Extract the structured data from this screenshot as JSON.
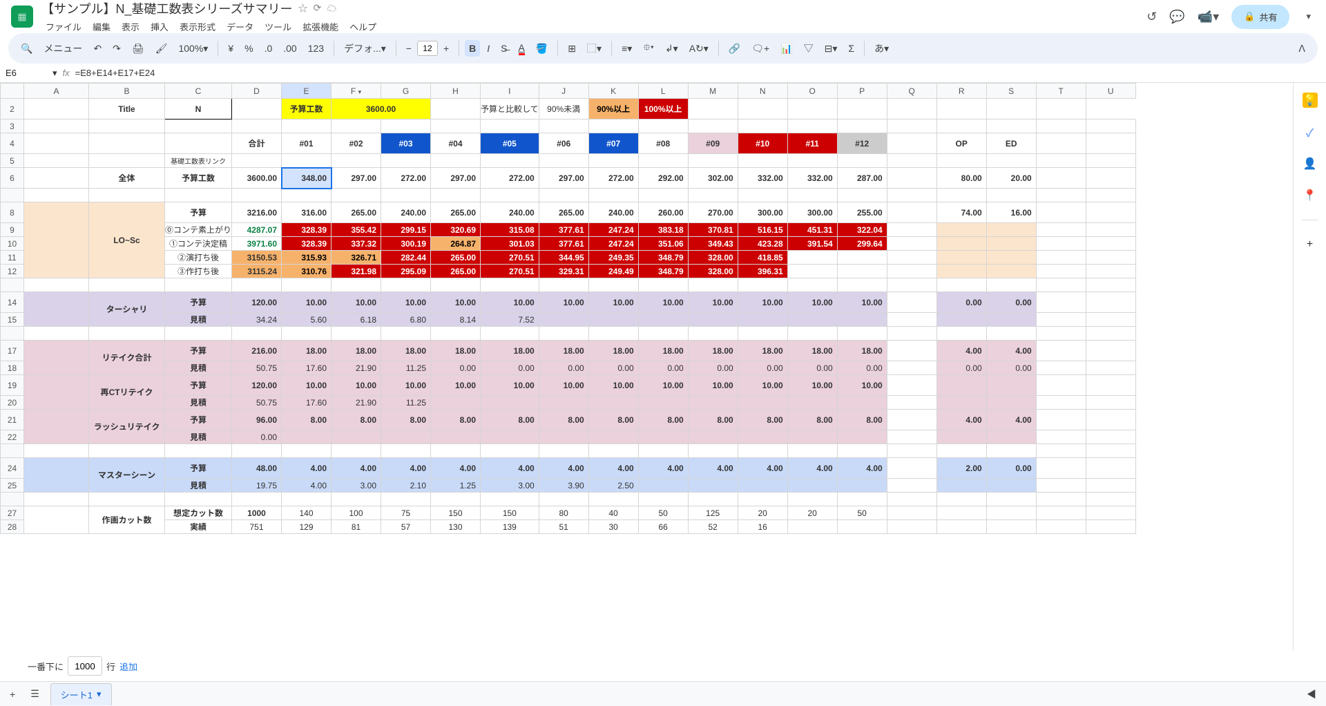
{
  "doc": {
    "title": "【サンプル】N_基礎工数表シリーズサマリー"
  },
  "menu": {
    "file": "ファイル",
    "edit": "編集",
    "view": "表示",
    "insert": "挿入",
    "format": "表示形式",
    "data": "データ",
    "tools": "ツール",
    "ext": "拡張機能",
    "help": "ヘルプ"
  },
  "share": "共有",
  "toolbar": {
    "menus": "メニュー",
    "zoom": "100%",
    "font": "デフォ...",
    "size": "12"
  },
  "namebox": "E6",
  "formula": "=E8+E14+E17+E24",
  "cols": [
    "A",
    "B",
    "C",
    "D",
    "E",
    "F",
    "G",
    "H",
    "I",
    "J",
    "K",
    "L",
    "M",
    "N",
    "O",
    "P",
    "Q",
    "R",
    "S",
    "T",
    "U"
  ],
  "row": {
    "2": "2",
    "3": "3",
    "4": "4",
    "5": "5",
    "6": "6",
    "8": "8",
    "9": "9",
    "10": "10",
    "11": "11",
    "12": "12",
    "14": "14",
    "15": "15",
    "17": "17",
    "18": "18",
    "19": "19",
    "20": "20",
    "21": "21",
    "22": "22",
    "24": "24",
    "25": "25",
    "27": "27",
    "28": "28"
  },
  "top": {
    "titleLbl": "Title",
    "titleVal": "N",
    "yosanLbl": "予算工数",
    "yosanVal": "3600.00",
    "compLbl": "予算と比較して",
    "lt90": "90%未満",
    "ge90": "90%以上",
    "ge100": "100%以上"
  },
  "hdr": {
    "sum": "合計",
    "eps": [
      "#01",
      "#02",
      "#03",
      "#04",
      "#05",
      "#06",
      "#07",
      "#08",
      "#09",
      "#10",
      "#11",
      "#12"
    ],
    "op": "OP",
    "ed": "ED"
  },
  "link": "基礎工数表リンク",
  "sec": {
    "zentai": "全体",
    "losc": "LO~Sc",
    "tertiary": "ターシャリ",
    "retake": "リテイク合計",
    "rect": "再CTリテイク",
    "rush": "ラッシュリテイク",
    "master": "マスターシーン",
    "cut": "作画カット数"
  },
  "lbl": {
    "yosanKosu": "予算工数",
    "yosan": "予算",
    "mitsumori": "見積",
    "c0": "⓪コンテ素上がり",
    "c1": "①コンテ決定稿",
    "c2": "②演打ち後",
    "c3": "③作打ち後",
    "soutei": "想定カット数",
    "jisseki": "実績"
  },
  "d": {
    "yk": {
      "sum": "3600.00",
      "v": [
        "348.00",
        "297.00",
        "272.00",
        "297.00",
        "272.00",
        "297.00",
        "272.00",
        "292.00",
        "302.00",
        "332.00",
        "332.00",
        "287.00"
      ],
      "op": "80.00",
      "ed": "20.00"
    },
    "losc_y": {
      "sum": "3216.00",
      "v": [
        "316.00",
        "265.00",
        "240.00",
        "265.00",
        "240.00",
        "265.00",
        "240.00",
        "260.00",
        "270.00",
        "300.00",
        "300.00",
        "255.00"
      ],
      "op": "74.00",
      "ed": "16.00"
    },
    "losc0": {
      "sum": "4287.07",
      "v": [
        "328.39",
        "355.42",
        "299.15",
        "320.69",
        "315.08",
        "377.61",
        "247.24",
        "383.18",
        "370.81",
        "516.15",
        "451.31",
        "322.04"
      ]
    },
    "losc1": {
      "sum": "3971.60",
      "v": [
        "328.39",
        "337.32",
        "300.19",
        "264.87",
        "301.03",
        "377.61",
        "247.24",
        "351.06",
        "349.43",
        "423.28",
        "391.54",
        "299.64"
      ]
    },
    "losc2": {
      "sum": "3150.53",
      "v": [
        "315.93",
        "326.71",
        "282.44",
        "265.00",
        "270.51",
        "344.95",
        "249.35",
        "348.79",
        "328.00",
        "418.85",
        "",
        ""
      ]
    },
    "losc3": {
      "sum": "3115.24",
      "v": [
        "310.76",
        "321.98",
        "295.09",
        "265.00",
        "270.51",
        "329.31",
        "249.49",
        "348.79",
        "328.00",
        "396.31",
        "",
        ""
      ]
    },
    "ter_y": {
      "sum": "120.00",
      "v": [
        "10.00",
        "10.00",
        "10.00",
        "10.00",
        "10.00",
        "10.00",
        "10.00",
        "10.00",
        "10.00",
        "10.00",
        "10.00",
        "10.00"
      ],
      "op": "0.00",
      "ed": "0.00"
    },
    "ter_m": {
      "sum": "34.24",
      "v": [
        "5.60",
        "6.18",
        "6.80",
        "8.14",
        "7.52",
        "",
        "",
        "",
        "",
        "",
        "",
        ""
      ]
    },
    "rt_y": {
      "sum": "216.00",
      "v": [
        "18.00",
        "18.00",
        "18.00",
        "18.00",
        "18.00",
        "18.00",
        "18.00",
        "18.00",
        "18.00",
        "18.00",
        "18.00",
        "18.00"
      ],
      "op": "4.00",
      "ed": "4.00"
    },
    "rt_m": {
      "sum": "50.75",
      "v": [
        "17.60",
        "21.90",
        "11.25",
        "0.00",
        "0.00",
        "0.00",
        "0.00",
        "0.00",
        "0.00",
        "0.00",
        "0.00",
        "0.00"
      ],
      "op": "0.00",
      "ed": "0.00"
    },
    "rc_y": {
      "sum": "120.00",
      "v": [
        "10.00",
        "10.00",
        "10.00",
        "10.00",
        "10.00",
        "10.00",
        "10.00",
        "10.00",
        "10.00",
        "10.00",
        "10.00",
        "10.00"
      ]
    },
    "rc_m": {
      "sum": "50.75",
      "v": [
        "17.60",
        "21.90",
        "11.25",
        "",
        "",
        "",
        "",
        "",
        "",
        "",
        "",
        ""
      ]
    },
    "ru_y": {
      "sum": "96.00",
      "v": [
        "8.00",
        "8.00",
        "8.00",
        "8.00",
        "8.00",
        "8.00",
        "8.00",
        "8.00",
        "8.00",
        "8.00",
        "8.00",
        "8.00"
      ],
      "op": "4.00",
      "ed": "4.00"
    },
    "ru_m": {
      "sum": "0.00",
      "v": [
        "",
        "",
        "",
        "",
        "",
        "",
        "",
        "",
        "",
        "",
        "",
        ""
      ]
    },
    "ms_y": {
      "sum": "48.00",
      "v": [
        "4.00",
        "4.00",
        "4.00",
        "4.00",
        "4.00",
        "4.00",
        "4.00",
        "4.00",
        "4.00",
        "4.00",
        "4.00",
        "4.00"
      ],
      "op": "2.00",
      "ed": "0.00"
    },
    "ms_m": {
      "sum": "19.75",
      "v": [
        "4.00",
        "3.00",
        "2.10",
        "1.25",
        "3.00",
        "3.90",
        "2.50",
        "",
        "",
        "",
        "",
        ""
      ]
    },
    "ct_s": {
      "sum": "1000",
      "v": [
        "140",
        "100",
        "75",
        "150",
        "150",
        "80",
        "40",
        "50",
        "125",
        "20",
        "20",
        "50"
      ]
    },
    "ct_j": {
      "sum": "751",
      "v": [
        "129",
        "81",
        "57",
        "130",
        "139",
        "51",
        "30",
        "66",
        "52",
        "16",
        "",
        ""
      ]
    }
  },
  "addrows": {
    "pre": "一番下に",
    "val": "1000",
    "unit": "行",
    "link": "追加"
  },
  "tab": "シート1"
}
